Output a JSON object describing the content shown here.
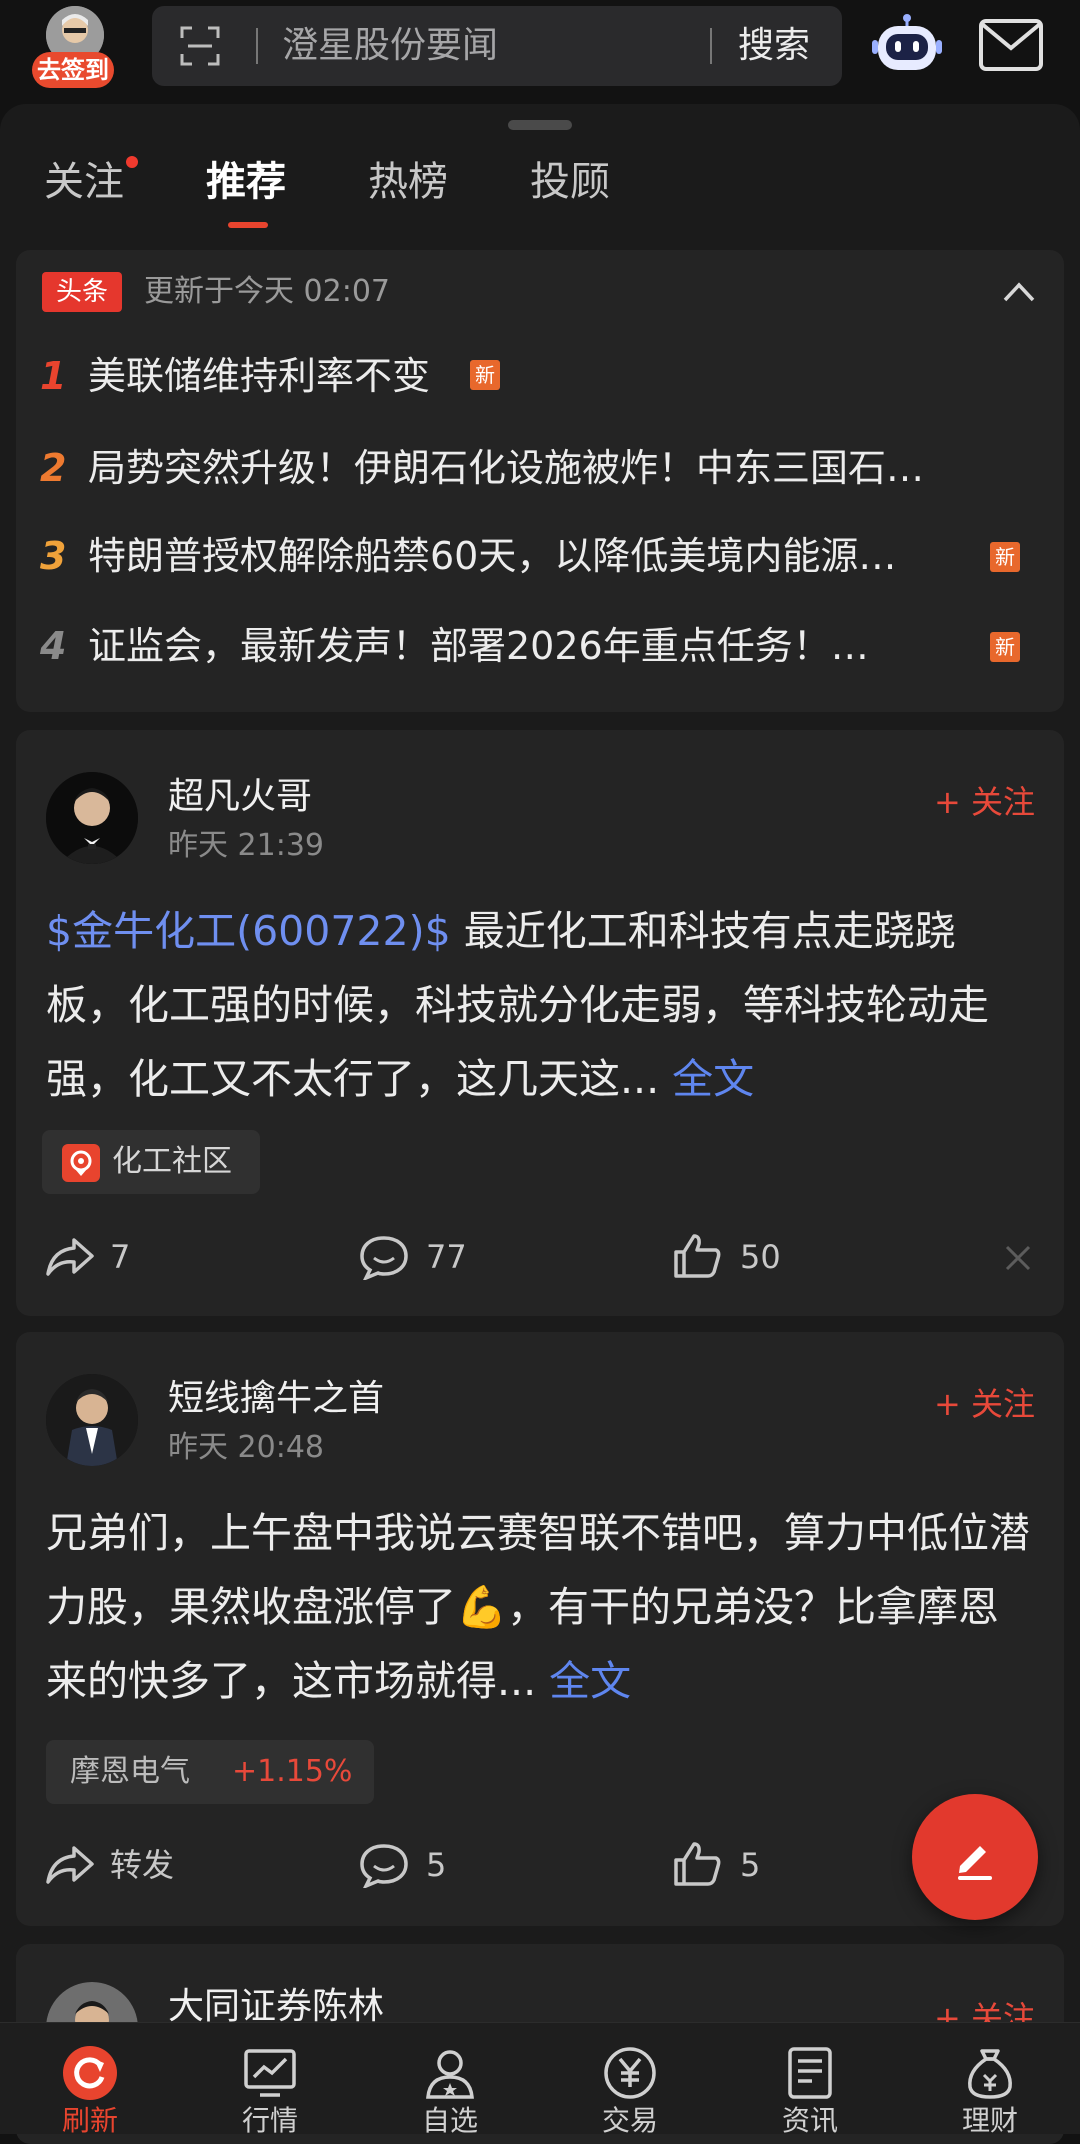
{
  "topbar": {
    "sign_in_label": "去签到",
    "search_placeholder": "澄星股份要闻",
    "search_button": "搜索"
  },
  "tabs": [
    {
      "label": "关注",
      "has_dot": true
    },
    {
      "label": "推荐",
      "active": true
    },
    {
      "label": "热榜"
    },
    {
      "label": "投顾"
    }
  ],
  "headlines": {
    "tag": "头条",
    "updated": "更新于今天 02:07",
    "items": [
      {
        "rank": "1",
        "text": "美联储维持利率不变",
        "new": "新",
        "rank_color": "#e8442e"
      },
      {
        "rank": "2",
        "text": "局势突然升级！伊朗石化设施被炸！中东三国石…",
        "rank_color": "#ee7a30"
      },
      {
        "rank": "3",
        "text": "特朗普授权解除船禁60天，以降低美境内能源…",
        "new": "新",
        "rank_color": "#f0a23a"
      },
      {
        "rank": "4",
        "text": "证监会，最新发声！部署2026年重点任务！…",
        "new": "新",
        "rank_color": "#8a8a8a"
      }
    ]
  },
  "posts": [
    {
      "author": "超凡火哥",
      "time": "昨天 21:39",
      "follow": "+ 关注",
      "stock_link": "$金牛化工(600722)$",
      "body": " 最近化工和科技有点走跷跷板，化工强的时候，科技就分化走弱，等科技轮动走强，化工又不太行了，这几天这...",
      "more": "全文",
      "chip_label": "化工社区",
      "share": "7",
      "comments": "77",
      "likes": "50"
    },
    {
      "author": "短线擒牛之首",
      "time": "昨天 20:48",
      "follow": "+ 关注",
      "body_a": "兄弟们，上午盘中我说云赛智联不错吧，算力中低位潜力股，果然收盘涨停了",
      "emoji": "💪",
      "body_b": "，有干的兄弟没？比拿摩恩来的快多了，这市场就得...",
      "more": "全文",
      "stock_name": "摩恩电气",
      "stock_change": "+1.15%",
      "share": "转发",
      "comments": "5",
      "likes": "5"
    },
    {
      "author": "大同证券陈林",
      "follow": "+ 关注"
    }
  ],
  "bottom_nav": [
    {
      "label": "刷新",
      "icon": "refresh-icon",
      "active": true
    },
    {
      "label": "行情",
      "icon": "chart-icon"
    },
    {
      "label": "自选",
      "icon": "user-star-icon"
    },
    {
      "label": "交易",
      "icon": "yuan-icon"
    },
    {
      "label": "资讯",
      "icon": "news-icon"
    },
    {
      "label": "理财",
      "icon": "money-bag-icon"
    }
  ],
  "colors": {
    "accent": "#e8442e",
    "link": "#6f8ff0",
    "stock_up": "#e8493a",
    "background": "#121212",
    "card": "#242424"
  }
}
